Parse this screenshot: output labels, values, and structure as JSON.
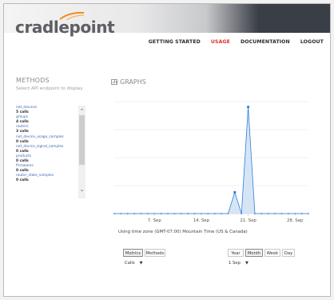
{
  "brand": {
    "logo_text": "cradlepoint"
  },
  "nav": {
    "items": [
      {
        "label": "GETTING STARTED",
        "active": false
      },
      {
        "label": "USAGE",
        "active": true
      },
      {
        "label": "DOCUMENTATION",
        "active": false
      },
      {
        "label": "LOGOUT",
        "active": false
      }
    ]
  },
  "methods": {
    "title": "METHODS",
    "subtitle": "Select API endpoint to display",
    "items": [
      {
        "name": "net_devices",
        "calls": "5 calls"
      },
      {
        "name": "groups",
        "calls": "4 calls"
      },
      {
        "name": "routers",
        "calls": "3 calls"
      },
      {
        "name": "net_device_usage_samples",
        "calls": "0 calls"
      },
      {
        "name": "net_device_signal_samples",
        "calls": "0 calls"
      },
      {
        "name": "products",
        "calls": "0 calls"
      },
      {
        "name": "firmwares",
        "calls": "0 calls"
      },
      {
        "name": "router_state_samples",
        "calls": "0 calls"
      }
    ]
  },
  "graphs": {
    "title": "GRAPHS",
    "timezone_text": "Using time zone (GMT-07:00) Mountain Time (US & Canada)",
    "toggle": {
      "metrics_label": "Metrics",
      "methods_label": "Methods",
      "selected": "Metrics"
    },
    "metric_select": "Calls",
    "range_buttons": [
      {
        "label": "Year",
        "selected": false
      },
      {
        "label": "Month",
        "selected": true
      },
      {
        "label": "Week",
        "selected": false
      },
      {
        "label": "Day",
        "selected": false
      }
    ],
    "date_select": "1 Sep"
  },
  "chart_data": {
    "type": "area",
    "x_tick_labels": [
      "7. Sep",
      "14. Sep",
      "21. Sep",
      "28. Sep"
    ],
    "x_tick_days": [
      7,
      14,
      21,
      28
    ],
    "x": [
      1,
      2,
      3,
      4,
      5,
      6,
      7,
      8,
      9,
      10,
      11,
      12,
      13,
      14,
      15,
      16,
      17,
      18,
      19,
      20,
      21,
      22,
      23,
      24,
      25,
      26,
      27,
      28,
      29,
      30
    ],
    "values": [
      0,
      0,
      0,
      0,
      0,
      0,
      0,
      0,
      0,
      0,
      0,
      0,
      0,
      0,
      0,
      0,
      0,
      0,
      1,
      0,
      5,
      0,
      0,
      0,
      0,
      0,
      0,
      0,
      0,
      0
    ],
    "color": "#2f7ed8",
    "grid": true,
    "xlim": [
      1,
      30
    ]
  }
}
